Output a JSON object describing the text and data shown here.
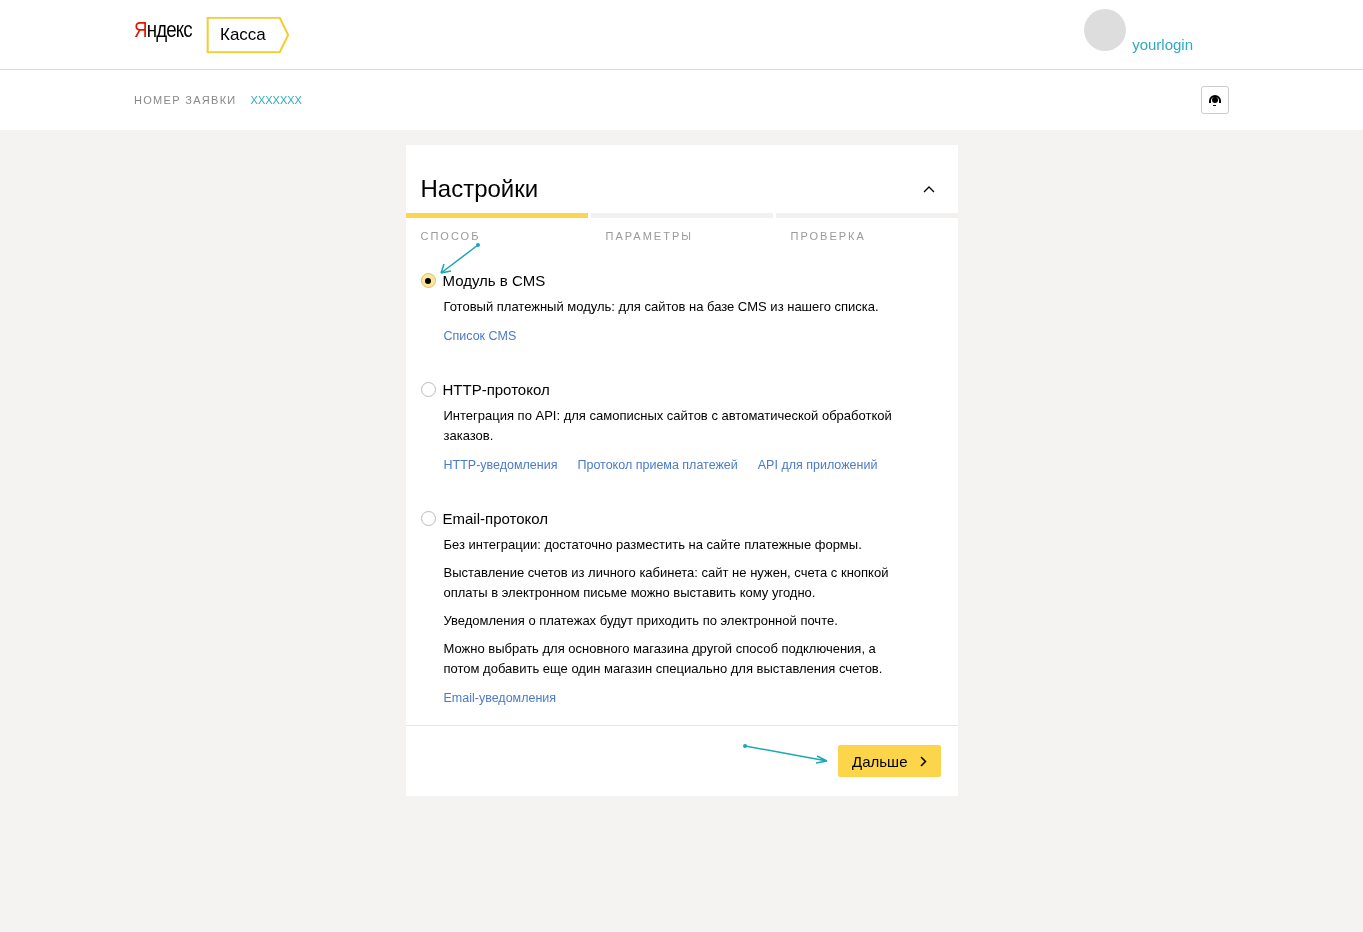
{
  "header": {
    "logo": "Яндекс",
    "product": "Касса",
    "user": {
      "login": "yourlogin"
    }
  },
  "subheader": {
    "label": "НОМЕР ЗАЯВКИ",
    "number": "XXXXXXX"
  },
  "card": {
    "title": "Настройки",
    "expanded": true,
    "steps": [
      {
        "label": "СПОСОБ",
        "done": true
      },
      {
        "label": "ПАРАМЕТРЫ",
        "done": false
      },
      {
        "label": "ПРОВЕРКА",
        "done": false
      }
    ],
    "options": [
      {
        "title": "Модуль в CMS",
        "selected": true,
        "paragraphs": [
          "Готовый платежный модуль: для сайтов на базе CMS из нашего списка."
        ],
        "links": [
          "Список CMS"
        ]
      },
      {
        "title": "HTTP-протокол",
        "selected": false,
        "paragraphs": [
          "Интеграция по API: для самописных сайтов с автоматической обработкой заказов."
        ],
        "links": [
          "HTTP-уведомления",
          "Протокол приема платежей",
          "API для приложений"
        ]
      },
      {
        "title": "Email-протокол",
        "selected": false,
        "paragraphs": [
          "Без интеграции: достаточно разместить на сайте платежные формы.",
          "Выставление счетов из личного кабинета: сайт не нужен, счета с кнопкой оплаты в электронном письме можно выставить кому угодно.",
          "Уведомления о платежах будут приходить по электронной почте.",
          "Можно выбрать для основного магазина другой способ подключения, а потом добавить еще один магазин специально для выставления счетов."
        ],
        "links": [
          "Email-уведомления"
        ]
      }
    ],
    "next_button": "Дальше"
  }
}
